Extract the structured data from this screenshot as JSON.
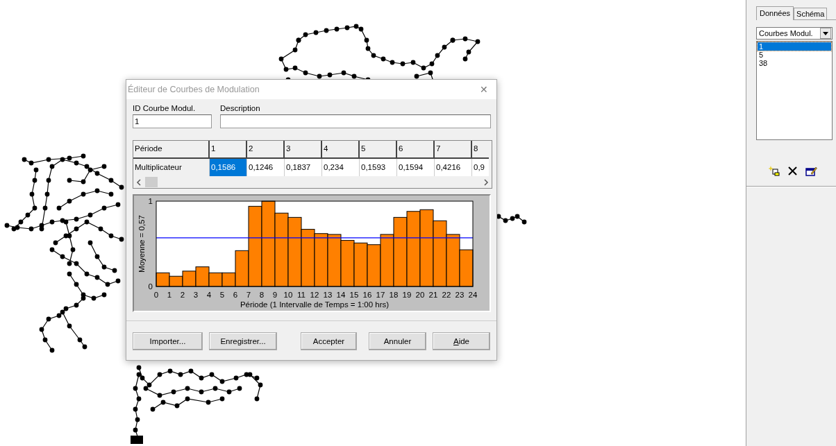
{
  "dialog": {
    "title": "Éditeur de Courbes de Modulation",
    "close_glyph": "✕",
    "id_field": {
      "label": "ID Courbe Modul.",
      "value": "1"
    },
    "description_field": {
      "label": "Description"
    },
    "grid": {
      "row_headers": [
        "Période",
        "Multiplicateur"
      ],
      "columns": [
        {
          "period": "1",
          "value": "0,1586",
          "selected": true
        },
        {
          "period": "2",
          "value": "0,1246",
          "selected": false
        },
        {
          "period": "3",
          "value": "0,1837",
          "selected": false
        },
        {
          "period": "4",
          "value": "0,234",
          "selected": false
        },
        {
          "period": "5",
          "value": "0,1593",
          "selected": false
        },
        {
          "period": "6",
          "value": "0,1594",
          "selected": false
        },
        {
          "period": "7",
          "value": "0,4216",
          "selected": false
        },
        {
          "period": "8",
          "value": "0,9",
          "selected": false
        }
      ]
    },
    "chart_data": {
      "type": "bar",
      "xlabel": "Période (1 Intervalle de Temps = 1:00  hrs)",
      "ylabel": "Moyenne = 0,57",
      "x": [
        0.5,
        1.5,
        2.5,
        3.5,
        4.5,
        5.5,
        6.5,
        7.5,
        8.5,
        9.5,
        10.5,
        11.5,
        12.5,
        13.5,
        14.5,
        15.5,
        16.5,
        17.5,
        18.5,
        19.5,
        20.5,
        21.5,
        22.5,
        23.5
      ],
      "series": [
        {
          "color": "#ff8000",
          "values": [
            0.16,
            0.12,
            0.18,
            0.23,
            0.16,
            0.16,
            0.42,
            0.94,
            1.0,
            0.86,
            0.81,
            0.67,
            0.62,
            0.61,
            0.54,
            0.51,
            0.49,
            0.61,
            0.81,
            0.88,
            0.9,
            0.77,
            0.61,
            0.43
          ]
        }
      ],
      "xlim": [
        0,
        24
      ],
      "ylim": [
        0,
        1
      ],
      "yticks": [
        0,
        1
      ],
      "xticks": [
        0,
        1,
        2,
        3,
        4,
        5,
        6,
        7,
        8,
        9,
        10,
        11,
        12,
        13,
        14,
        15,
        16,
        17,
        18,
        19,
        20,
        21,
        22,
        23,
        24
      ],
      "ref_lines": [
        {
          "axis": "y",
          "value": 0.57,
          "color": "#0000ff"
        }
      ]
    },
    "buttons": [
      {
        "label": "Importer..."
      },
      {
        "label": "Enregistrer..."
      },
      {
        "label": "Accepter"
      },
      {
        "label": "Annuler"
      },
      {
        "label": "Aide",
        "underline_first": true
      }
    ]
  },
  "browser_panel": {
    "tabs": [
      {
        "label": "Données",
        "selected": true
      },
      {
        "label": "Schéma",
        "selected": false
      }
    ],
    "category_dropdown": {
      "value": "Courbes Modul."
    },
    "items": [
      {
        "label": "1",
        "selected": true
      },
      {
        "label": "5",
        "selected": false
      },
      {
        "label": "38",
        "selected": false
      }
    ]
  }
}
